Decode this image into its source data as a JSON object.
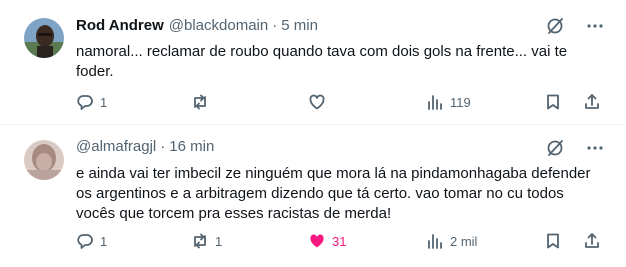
{
  "tweets": [
    {
      "name": "Rod Andrew",
      "handle": "@blackdomain",
      "time": "5 min",
      "text": "namoral... reclamar de roubo quando tava com dois gols na frente... vai te foder.",
      "replies": "1",
      "reposts": "",
      "likes": "",
      "views": "119",
      "liked": false
    },
    {
      "name": "",
      "handle": "@almafragjl",
      "time": "16 min",
      "text": "e ainda vai ter imbecil ze ninguém que mora lá na pindamonhagaba defender os argentinos e a arbitragem dizendo que tá certo. vao tomar no cu todos vocês que torcem pra esses racistas de merda!",
      "replies": "1",
      "reposts": "1",
      "likes": "31",
      "views": "2 mil",
      "liked": true,
      "like_color": "#f91880"
    }
  ],
  "icons": {
    "reply": "reply-icon",
    "repost": "repost-icon",
    "like": "heart-icon",
    "views": "views-icon",
    "bookmark": "bookmark-icon",
    "share": "share-icon",
    "grok": "grok-icon",
    "more": "more-icon"
  }
}
